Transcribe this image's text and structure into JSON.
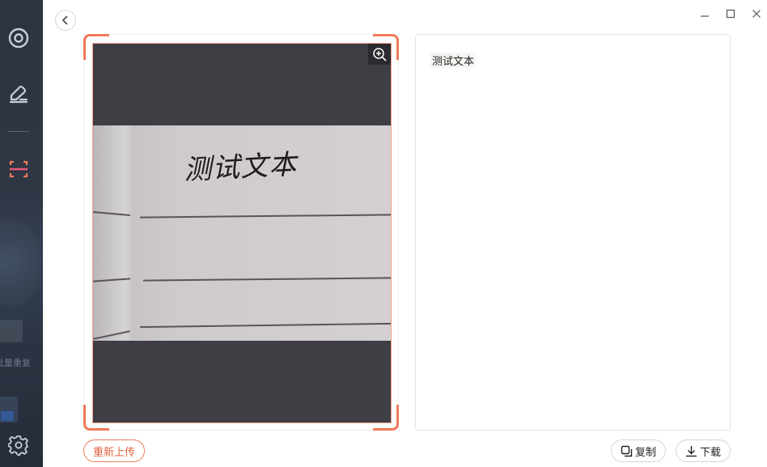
{
  "sidebar": {
    "items": [
      {
        "icon": "scan-target-icon"
      },
      {
        "icon": "edit-sign-icon"
      },
      {
        "icon": "text-scan-icon",
        "active": true
      }
    ],
    "settings_icon": "gear-icon",
    "ghost_text": "批量重复"
  },
  "window": {
    "back_icon": "chevron-left-icon",
    "minimize_icon": "minimize-icon",
    "maximize_icon": "maximize-icon",
    "close_icon": "close-icon"
  },
  "image_panel": {
    "handwriting": "测试文本",
    "zoom_icon": "zoom-in-icon",
    "accent_color": "#f07b5a"
  },
  "result_panel": {
    "text": "测试文本"
  },
  "actions": {
    "reupload_label": "重新上传",
    "copy_label": "复制",
    "download_label": "下载"
  }
}
